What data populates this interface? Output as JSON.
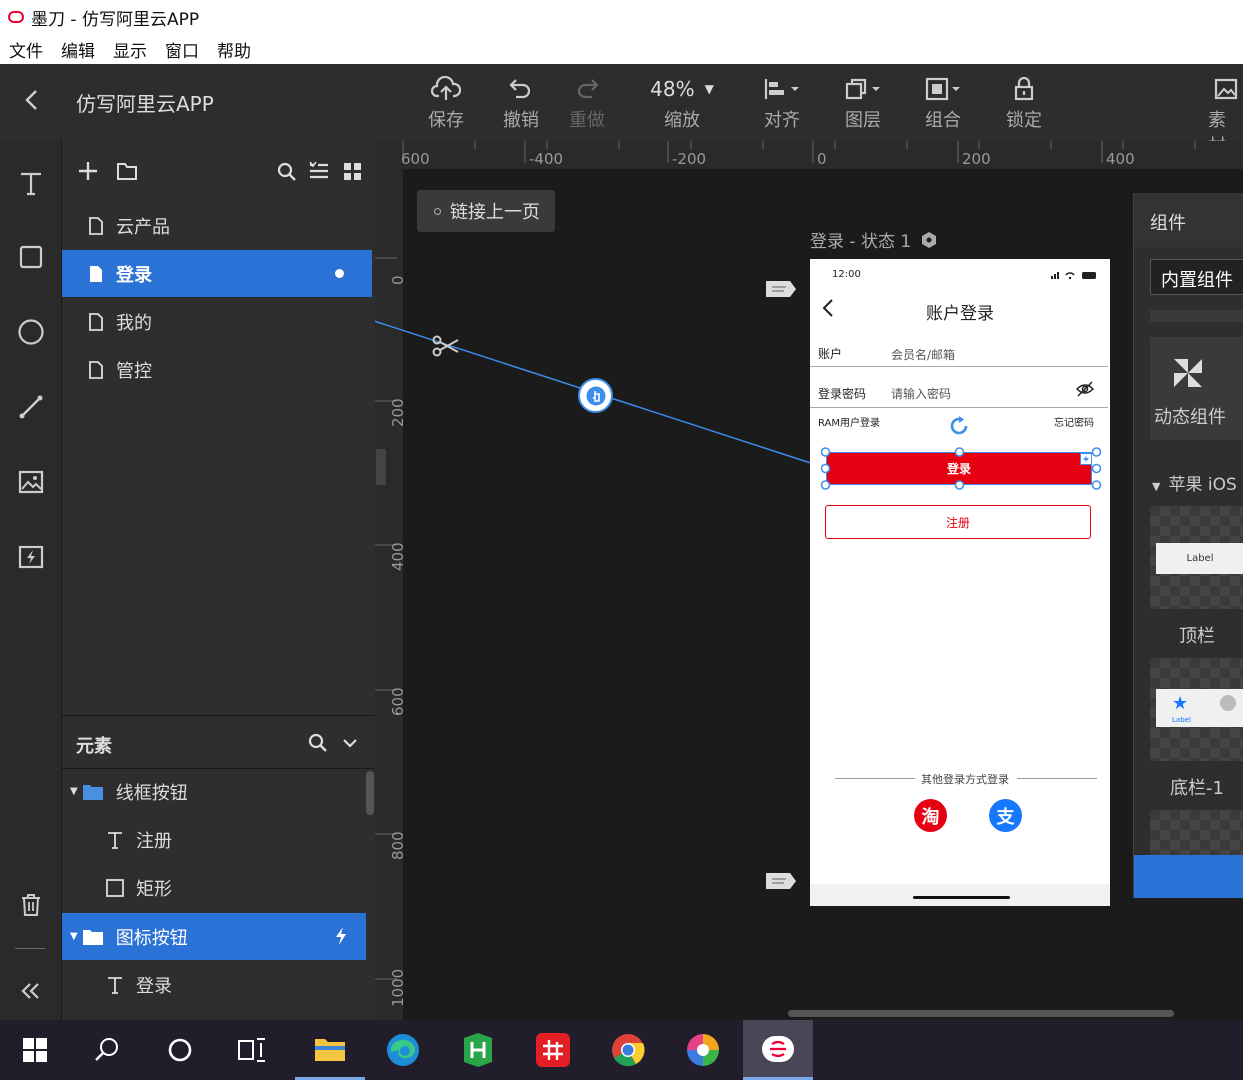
{
  "window": {
    "title": "墨刀 - 仿写阿里云APP"
  },
  "menu": [
    "文件",
    "编辑",
    "显示",
    "窗口",
    "帮助"
  ],
  "toolbar": {
    "project_name": "仿写阿里云APP",
    "save": "保存",
    "undo": "撤销",
    "redo": "重做",
    "zoom_value": "48%",
    "zoom_label": "缩放",
    "align": "对齐",
    "layer": "图层",
    "group": "组合",
    "lock": "锁定",
    "assets": "素材"
  },
  "pages": {
    "items": [
      {
        "label": "云产品",
        "active": false
      },
      {
        "label": "登录",
        "active": true
      },
      {
        "label": "我的",
        "active": false
      },
      {
        "label": "管控",
        "active": false
      }
    ]
  },
  "elements": {
    "title": "元素",
    "items": [
      {
        "label": "线框按钮",
        "type": "folder"
      },
      {
        "label": "注册",
        "type": "text"
      },
      {
        "label": "矩形",
        "type": "rect"
      },
      {
        "label": "图标按钮",
        "type": "folder",
        "active": true
      },
      {
        "label": "登录",
        "type": "text"
      }
    ]
  },
  "canvas": {
    "ruler_top": [
      "600",
      "-400",
      "-200",
      "0",
      "200",
      "400"
    ],
    "ruler_left": [
      "0",
      "200",
      "400",
      "600",
      "800",
      "1000"
    ],
    "link_prev": "链接上一页",
    "state_label": "登录 - 状态 1"
  },
  "phone": {
    "time": "12:00",
    "title": "账户登录",
    "account_label": "账户",
    "account_placeholder": "会员名/邮箱",
    "password_label": "登录密码",
    "password_placeholder": "请输入密码",
    "ram_login": "RAM用户登录",
    "forgot": "忘记密码",
    "login_button": "登录",
    "register_button": "注册",
    "other_login": "其他登录方式登录",
    "taobao": "淘",
    "alipay": "支"
  },
  "components": {
    "title": "组件",
    "builtin_tab": "内置组件",
    "dynamic": "动态组件",
    "ios_section": "苹果 iOS",
    "topbar": "顶栏",
    "topbar_label": "Label",
    "bottombar": "底栏-1",
    "bottombar_label": "Label"
  },
  "colors": {
    "accent": "#2b72d6",
    "login_red": "#e60012",
    "toolbar": "#2d2d2d"
  }
}
